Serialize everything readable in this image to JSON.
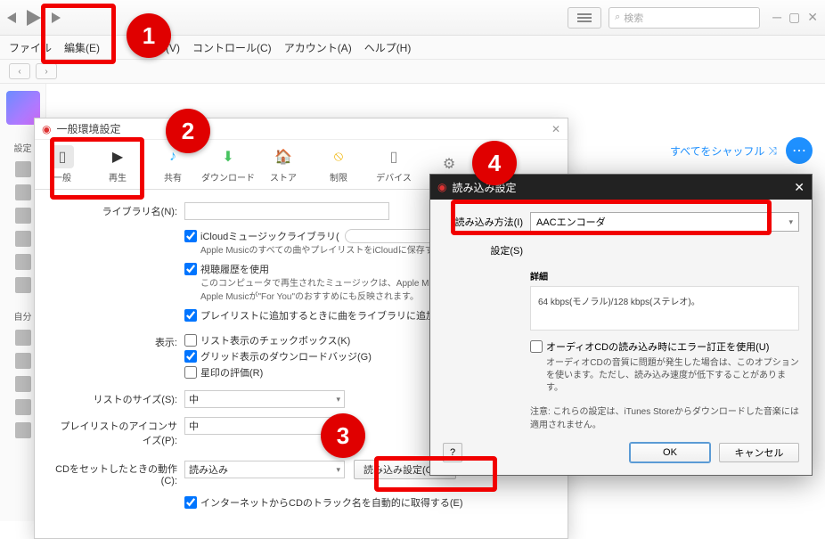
{
  "titlebar": {
    "search_placeholder": "検索"
  },
  "menu": {
    "file": "ファイル",
    "edit": "編集(E)",
    "view": "表示(V)",
    "control": "コントロール(C)",
    "account": "アカウント(A)",
    "help": "ヘルプ(H)"
  },
  "sidebar": {
    "settings_label": "設定",
    "self_label": "自分"
  },
  "shuffle": {
    "label": "すべてをシャッフル"
  },
  "prefs": {
    "title": "一般環境設定",
    "tabs": {
      "general": "一般",
      "playback": "再生",
      "sharing": "共有",
      "download": "ダウンロード",
      "store": "ストア",
      "restrict": "制限",
      "device": "デバイス",
      "advanced": ""
    },
    "library_name_label": "ライブラリ名(N):",
    "icloud_check": "iCloudミュージックライブラリ(",
    "icloud_help": "Apple Musicのすべての曲やプレイリストをiCloudに保存すれば、お使",
    "history_check": "視聴履歴を使用",
    "history_help1": "このコンピュータで再生されたミュージックは、Apple Musicであなたをフォ",
    "history_help2": "Apple Musicが\"For You\"のおすすめにも反映されます。",
    "add_to_library_check": "プレイリストに追加するときに曲をライブラリに追加(D)",
    "view_label": "表示:",
    "list_check": "リスト表示のチェックボックス(K)",
    "grid_check": "グリッド表示のダウンロードバッジ(G)",
    "star_check": "星印の評価(R)",
    "list_size_label": "リストのサイズ(S):",
    "list_size_value": "中",
    "icon_size_label": "プレイリストのアイコンサイズ(P):",
    "icon_size_value": "中",
    "cd_action_label": "CDをセットしたときの動作(C):",
    "cd_action_value": "読み込み",
    "import_settings_btn": "読み込み設定(O)…",
    "cd_track_check": "インターネットからCDのトラック名を自動的に取得する(E)"
  },
  "dlg": {
    "title": "読み込み設定",
    "method_label": "読み込み方法(I)",
    "method_value": "AACエンコーダ",
    "setting_label": "設定(S)",
    "details_heading": "詳細",
    "details_text": "64 kbps(モノラル)/128 kbps(ステレオ)。",
    "error_check": "オーディオCDの読み込み時にエラー訂正を使用(U)",
    "error_help": "オーディオCDの音質に問題が発生した場合は、このオプションを使います。ただし、読み込み速度が低下することがあります。",
    "note": "注意: これらの設定は、iTunes Storeからダウンロードした音楽には適用されません。",
    "ok": "OK",
    "cancel": "キャンセル"
  },
  "badges": {
    "b1": "1",
    "b2": "2",
    "b3": "3",
    "b4": "4"
  }
}
